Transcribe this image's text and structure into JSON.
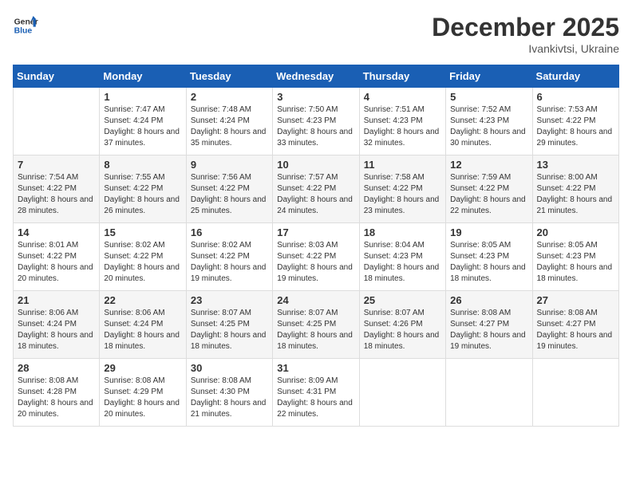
{
  "logo": {
    "line1": "General",
    "line2": "Blue"
  },
  "title": "December 2025",
  "subtitle": "Ivankivtsi, Ukraine",
  "days_of_week": [
    "Sunday",
    "Monday",
    "Tuesday",
    "Wednesday",
    "Thursday",
    "Friday",
    "Saturday"
  ],
  "weeks": [
    [
      {
        "day": "",
        "sunrise": "",
        "sunset": "",
        "daylight": ""
      },
      {
        "day": "1",
        "sunrise": "Sunrise: 7:47 AM",
        "sunset": "Sunset: 4:24 PM",
        "daylight": "Daylight: 8 hours and 37 minutes."
      },
      {
        "day": "2",
        "sunrise": "Sunrise: 7:48 AM",
        "sunset": "Sunset: 4:24 PM",
        "daylight": "Daylight: 8 hours and 35 minutes."
      },
      {
        "day": "3",
        "sunrise": "Sunrise: 7:50 AM",
        "sunset": "Sunset: 4:23 PM",
        "daylight": "Daylight: 8 hours and 33 minutes."
      },
      {
        "day": "4",
        "sunrise": "Sunrise: 7:51 AM",
        "sunset": "Sunset: 4:23 PM",
        "daylight": "Daylight: 8 hours and 32 minutes."
      },
      {
        "day": "5",
        "sunrise": "Sunrise: 7:52 AM",
        "sunset": "Sunset: 4:23 PM",
        "daylight": "Daylight: 8 hours and 30 minutes."
      },
      {
        "day": "6",
        "sunrise": "Sunrise: 7:53 AM",
        "sunset": "Sunset: 4:22 PM",
        "daylight": "Daylight: 8 hours and 29 minutes."
      }
    ],
    [
      {
        "day": "7",
        "sunrise": "Sunrise: 7:54 AM",
        "sunset": "Sunset: 4:22 PM",
        "daylight": "Daylight: 8 hours and 28 minutes."
      },
      {
        "day": "8",
        "sunrise": "Sunrise: 7:55 AM",
        "sunset": "Sunset: 4:22 PM",
        "daylight": "Daylight: 8 hours and 26 minutes."
      },
      {
        "day": "9",
        "sunrise": "Sunrise: 7:56 AM",
        "sunset": "Sunset: 4:22 PM",
        "daylight": "Daylight: 8 hours and 25 minutes."
      },
      {
        "day": "10",
        "sunrise": "Sunrise: 7:57 AM",
        "sunset": "Sunset: 4:22 PM",
        "daylight": "Daylight: 8 hours and 24 minutes."
      },
      {
        "day": "11",
        "sunrise": "Sunrise: 7:58 AM",
        "sunset": "Sunset: 4:22 PM",
        "daylight": "Daylight: 8 hours and 23 minutes."
      },
      {
        "day": "12",
        "sunrise": "Sunrise: 7:59 AM",
        "sunset": "Sunset: 4:22 PM",
        "daylight": "Daylight: 8 hours and 22 minutes."
      },
      {
        "day": "13",
        "sunrise": "Sunrise: 8:00 AM",
        "sunset": "Sunset: 4:22 PM",
        "daylight": "Daylight: 8 hours and 21 minutes."
      }
    ],
    [
      {
        "day": "14",
        "sunrise": "Sunrise: 8:01 AM",
        "sunset": "Sunset: 4:22 PM",
        "daylight": "Daylight: 8 hours and 20 minutes."
      },
      {
        "day": "15",
        "sunrise": "Sunrise: 8:02 AM",
        "sunset": "Sunset: 4:22 PM",
        "daylight": "Daylight: 8 hours and 20 minutes."
      },
      {
        "day": "16",
        "sunrise": "Sunrise: 8:02 AM",
        "sunset": "Sunset: 4:22 PM",
        "daylight": "Daylight: 8 hours and 19 minutes."
      },
      {
        "day": "17",
        "sunrise": "Sunrise: 8:03 AM",
        "sunset": "Sunset: 4:22 PM",
        "daylight": "Daylight: 8 hours and 19 minutes."
      },
      {
        "day": "18",
        "sunrise": "Sunrise: 8:04 AM",
        "sunset": "Sunset: 4:23 PM",
        "daylight": "Daylight: 8 hours and 18 minutes."
      },
      {
        "day": "19",
        "sunrise": "Sunrise: 8:05 AM",
        "sunset": "Sunset: 4:23 PM",
        "daylight": "Daylight: 8 hours and 18 minutes."
      },
      {
        "day": "20",
        "sunrise": "Sunrise: 8:05 AM",
        "sunset": "Sunset: 4:23 PM",
        "daylight": "Daylight: 8 hours and 18 minutes."
      }
    ],
    [
      {
        "day": "21",
        "sunrise": "Sunrise: 8:06 AM",
        "sunset": "Sunset: 4:24 PM",
        "daylight": "Daylight: 8 hours and 18 minutes."
      },
      {
        "day": "22",
        "sunrise": "Sunrise: 8:06 AM",
        "sunset": "Sunset: 4:24 PM",
        "daylight": "Daylight: 8 hours and 18 minutes."
      },
      {
        "day": "23",
        "sunrise": "Sunrise: 8:07 AM",
        "sunset": "Sunset: 4:25 PM",
        "daylight": "Daylight: 8 hours and 18 minutes."
      },
      {
        "day": "24",
        "sunrise": "Sunrise: 8:07 AM",
        "sunset": "Sunset: 4:25 PM",
        "daylight": "Daylight: 8 hours and 18 minutes."
      },
      {
        "day": "25",
        "sunrise": "Sunrise: 8:07 AM",
        "sunset": "Sunset: 4:26 PM",
        "daylight": "Daylight: 8 hours and 18 minutes."
      },
      {
        "day": "26",
        "sunrise": "Sunrise: 8:08 AM",
        "sunset": "Sunset: 4:27 PM",
        "daylight": "Daylight: 8 hours and 19 minutes."
      },
      {
        "day": "27",
        "sunrise": "Sunrise: 8:08 AM",
        "sunset": "Sunset: 4:27 PM",
        "daylight": "Daylight: 8 hours and 19 minutes."
      }
    ],
    [
      {
        "day": "28",
        "sunrise": "Sunrise: 8:08 AM",
        "sunset": "Sunset: 4:28 PM",
        "daylight": "Daylight: 8 hours and 20 minutes."
      },
      {
        "day": "29",
        "sunrise": "Sunrise: 8:08 AM",
        "sunset": "Sunset: 4:29 PM",
        "daylight": "Daylight: 8 hours and 20 minutes."
      },
      {
        "day": "30",
        "sunrise": "Sunrise: 8:08 AM",
        "sunset": "Sunset: 4:30 PM",
        "daylight": "Daylight: 8 hours and 21 minutes."
      },
      {
        "day": "31",
        "sunrise": "Sunrise: 8:09 AM",
        "sunset": "Sunset: 4:31 PM",
        "daylight": "Daylight: 8 hours and 22 minutes."
      },
      {
        "day": "",
        "sunrise": "",
        "sunset": "",
        "daylight": ""
      },
      {
        "day": "",
        "sunrise": "",
        "sunset": "",
        "daylight": ""
      },
      {
        "day": "",
        "sunrise": "",
        "sunset": "",
        "daylight": ""
      }
    ]
  ]
}
